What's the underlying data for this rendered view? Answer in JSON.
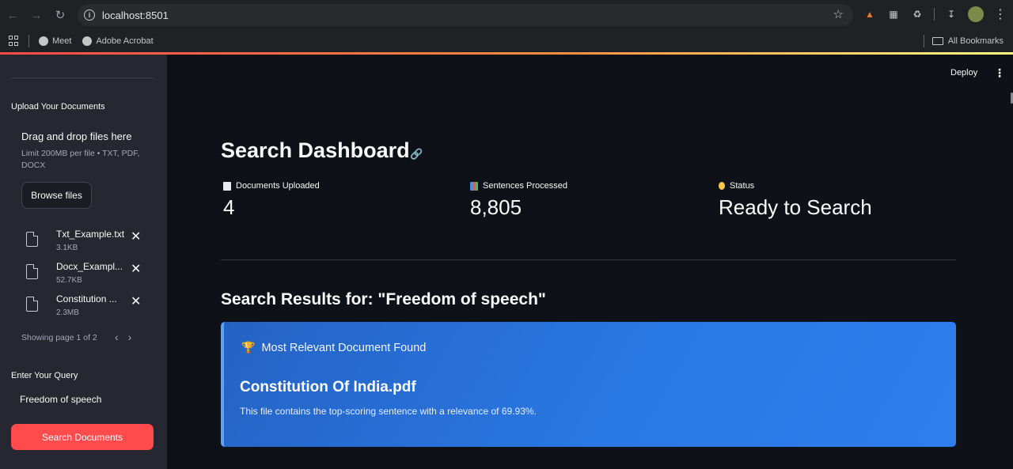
{
  "browser": {
    "url": "localhost:8501",
    "bookmarks": [
      {
        "label": "Meet"
      },
      {
        "label": "Adobe Acrobat"
      }
    ],
    "all_bookmarks": "All Bookmarks"
  },
  "sidebar": {
    "upload_label": "Upload Your Documents",
    "drop_title": "Drag and drop files here",
    "drop_limit": "Limit 200MB per file • TXT, PDF, DOCX",
    "browse_label": "Browse files",
    "files": [
      {
        "name": "Txt_Example.txt",
        "size": "3.1KB"
      },
      {
        "name": "Docx_Exampl...",
        "size": "52.7KB"
      },
      {
        "name": "Constitution ...",
        "size": "2.3MB"
      }
    ],
    "pager_text": "Showing page 1 of 2",
    "query_label": "Enter Your Query",
    "query_value": "Freedom of speech",
    "search_button": "Search Documents"
  },
  "header": {
    "deploy_label": "Deploy"
  },
  "main": {
    "title": "Search Dashboard",
    "metrics": [
      {
        "icon": "document-icon",
        "label": "Documents Uploaded",
        "value": "4"
      },
      {
        "icon": "bar-chart-icon",
        "label": "Sentences Processed",
        "value": "8,805"
      },
      {
        "icon": "lightbulb-icon",
        "label": "Status",
        "value": "Ready to Search"
      }
    ],
    "results_title": "Search Results for: \"Freedom of speech\"",
    "result_card": {
      "heading": "Most Relevant Document Found",
      "document": "Constitution Of India.pdf",
      "description": "This file contains the top-scoring sentence with a relevance of 69.93%."
    }
  },
  "colors": {
    "accent": "#ff4b4b",
    "card": "#2a78e3",
    "background": "#0e1117",
    "sidebar": "#262730"
  }
}
